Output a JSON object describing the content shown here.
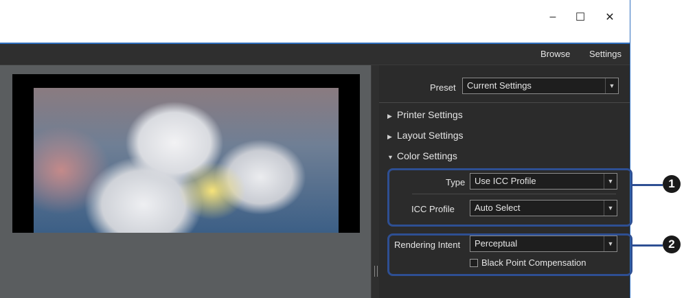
{
  "window": {
    "minimize": "–",
    "maximize": "☐",
    "close": "✕"
  },
  "menubar": {
    "browse": "Browse",
    "settings": "Settings"
  },
  "panel": {
    "preset": {
      "label": "Preset",
      "value": "Current Settings"
    },
    "sections": {
      "printer": {
        "label": "Printer Settings",
        "expanded": false
      },
      "layout": {
        "label": "Layout Settings",
        "expanded": false
      },
      "color": {
        "label": "Color Settings",
        "expanded": true
      }
    },
    "color": {
      "type": {
        "label": "Type",
        "value": "Use ICC Profile"
      },
      "icc_profile": {
        "label": "ICC Profile",
        "value": "Auto Select"
      },
      "rendering_intent": {
        "label": "Rendering Intent",
        "value": "Perceptual"
      },
      "black_point": {
        "label": "Black Point Compensation",
        "checked": false
      }
    }
  },
  "callouts": {
    "one": "1",
    "two": "2"
  },
  "colors": {
    "accent": "#2e4f93",
    "panel_bg": "#2b2b2b",
    "preview_bg": "#5a5d5f"
  },
  "icons": {
    "dropdown": "▼",
    "collapsed": "▶",
    "expanded": "▼"
  }
}
